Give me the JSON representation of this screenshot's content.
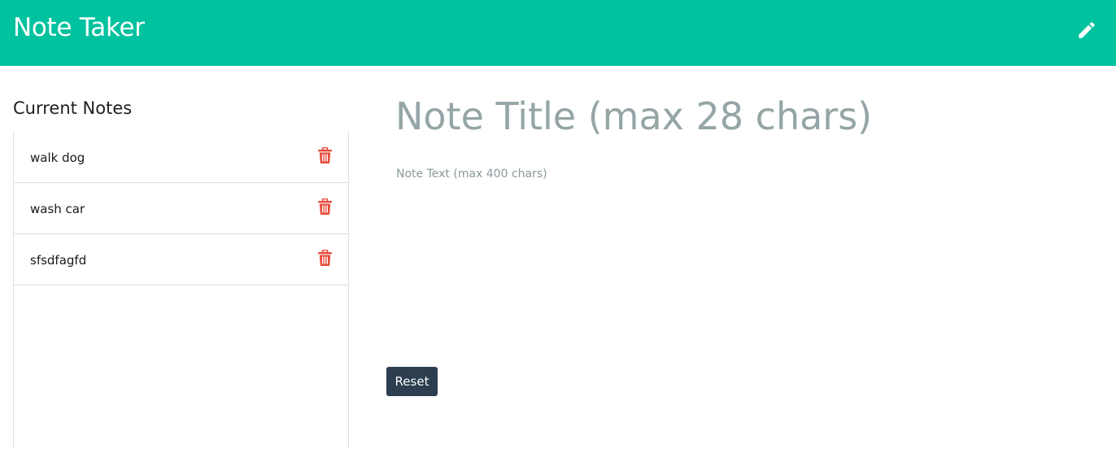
{
  "app": {
    "title": "Note Taker",
    "new_note_icon": "pencil-icon"
  },
  "colors": {
    "navbar": "#00c29e",
    "delete": "#e74c3c",
    "button": "#2c3e50",
    "placeholder": "#95a5a6"
  },
  "sidebar": {
    "title": "Current Notes",
    "delete_icon": "trash-icon",
    "notes": [
      {
        "title": "walk dog"
      },
      {
        "title": "wash car"
      },
      {
        "title": "sfsdfagfd"
      }
    ]
  },
  "editor": {
    "title_value": "",
    "title_placeholder": "Note Title (max 28 chars)",
    "text_value": "",
    "text_placeholder": "Note Text (max 400 chars)",
    "reset_label": "Reset"
  }
}
